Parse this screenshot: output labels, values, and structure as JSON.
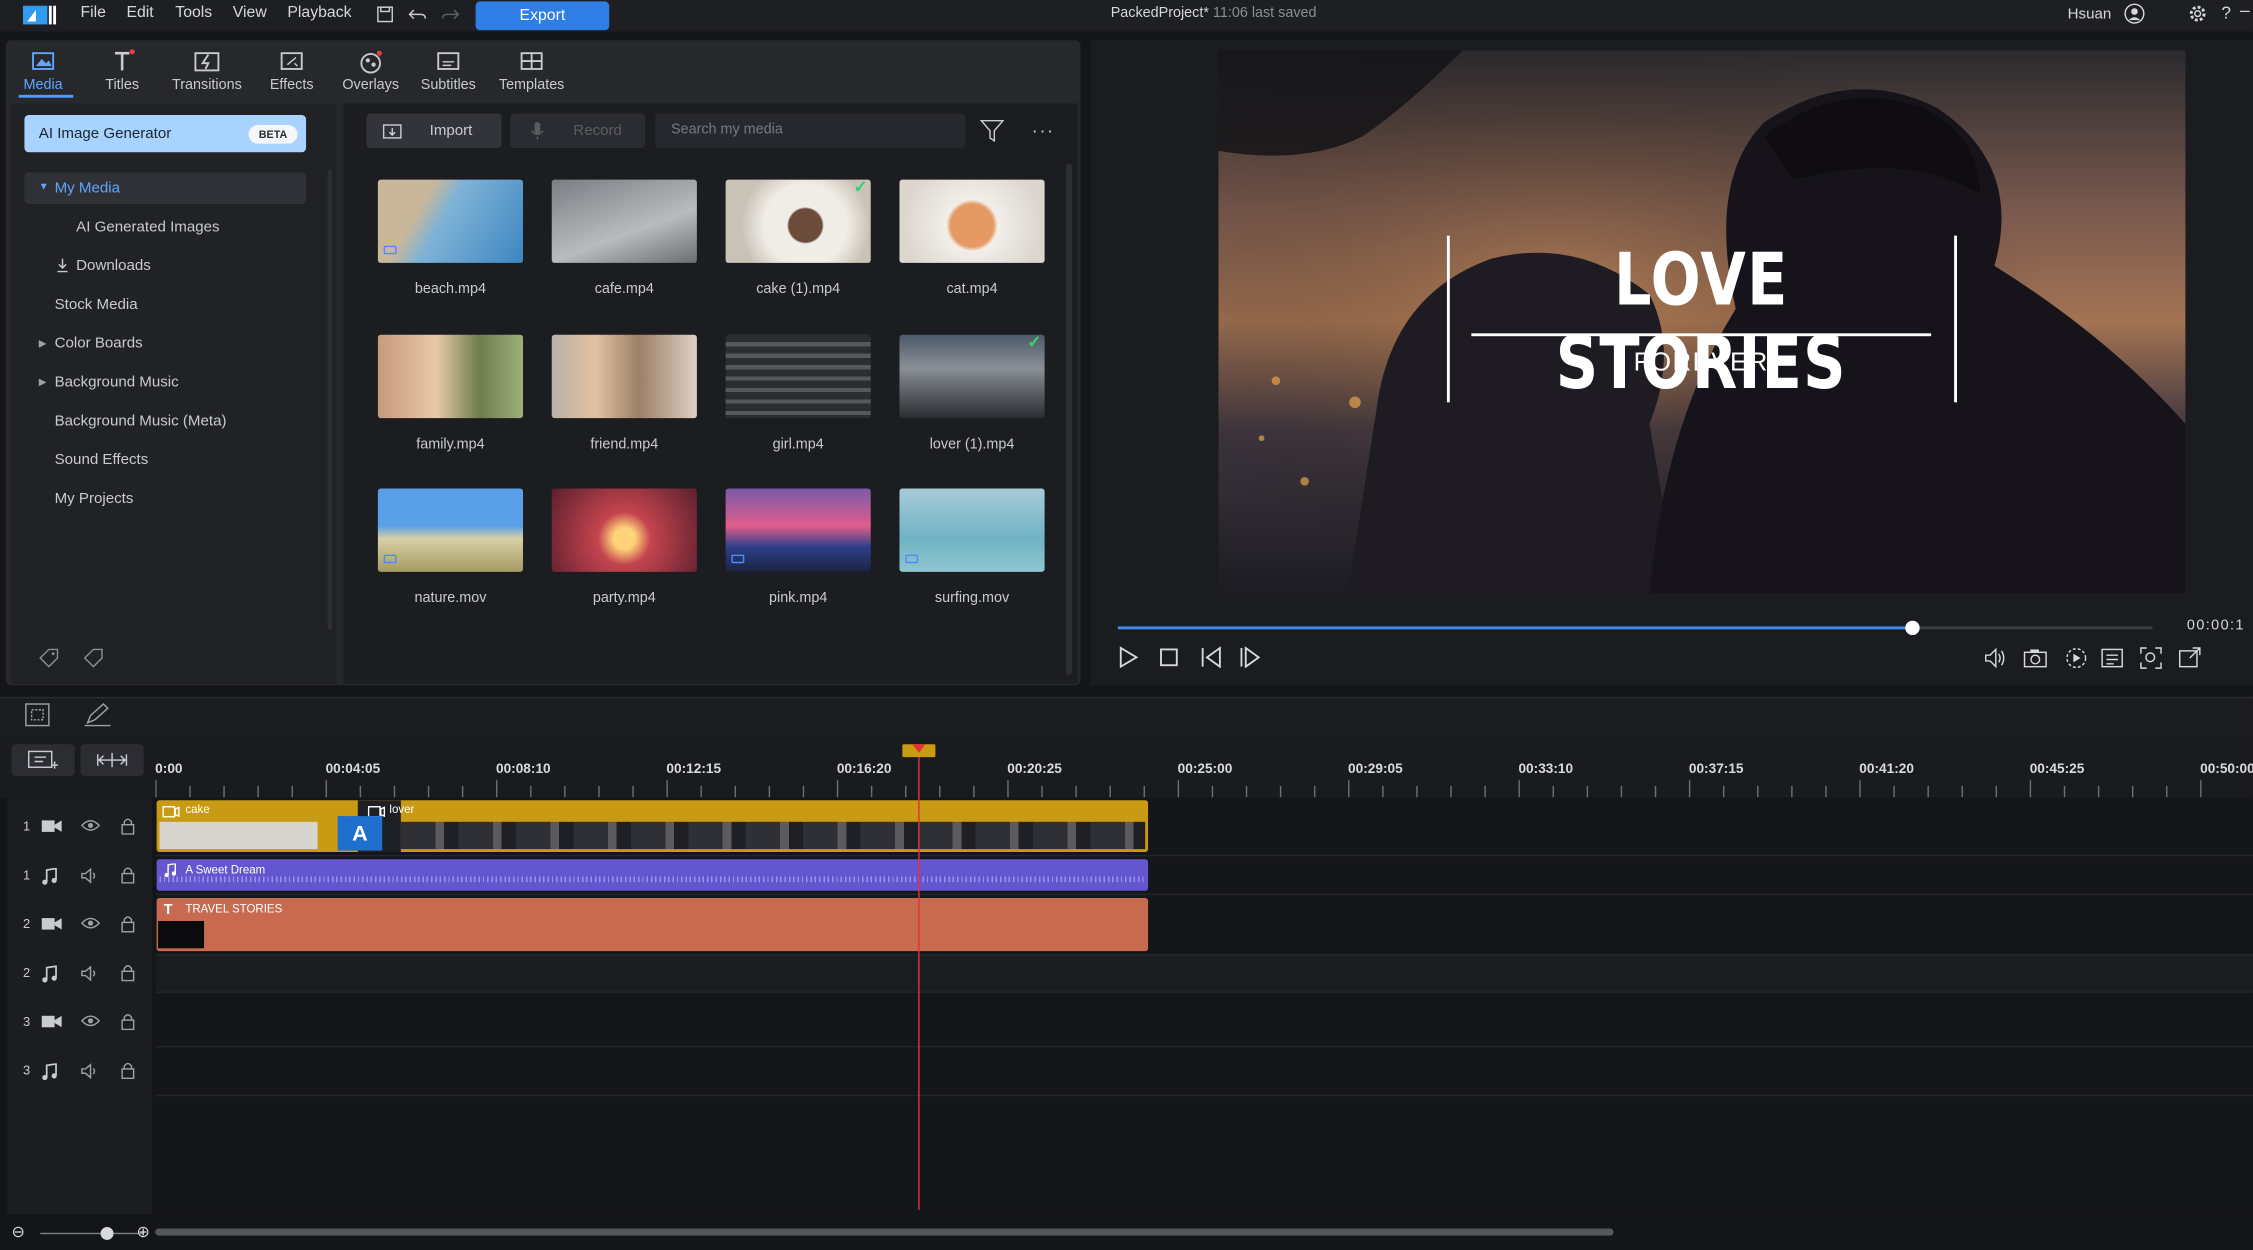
{
  "menu": {
    "items": [
      "File",
      "Edit",
      "Tools",
      "View",
      "Playback"
    ],
    "export_label": "Export"
  },
  "project": {
    "name": "PackedProject*",
    "saved": "11:06 last saved"
  },
  "user": {
    "name": "Hsuan"
  },
  "tabs": [
    {
      "label": "Media",
      "icon": "media-icon",
      "active": true
    },
    {
      "label": "Titles",
      "icon": "titles-icon"
    },
    {
      "label": "Transitions",
      "icon": "transitions-icon"
    },
    {
      "label": "Effects",
      "icon": "effects-icon"
    },
    {
      "label": "Overlays",
      "icon": "overlays-icon"
    },
    {
      "label": "Subtitles",
      "icon": "subtitles-icon"
    },
    {
      "label": "Templates",
      "icon": "templates-icon"
    }
  ],
  "sidebar": {
    "ai_generator": "AI Image Generator",
    "beta": "BETA",
    "items": [
      {
        "label": "My Media",
        "expanded": true
      },
      {
        "label": "AI Generated Images"
      },
      {
        "label": "Downloads"
      },
      {
        "label": "Stock Media"
      },
      {
        "label": "Color Boards"
      },
      {
        "label": "Background Music"
      },
      {
        "label": "Background Music (Meta)"
      },
      {
        "label": "Sound Effects"
      },
      {
        "label": "My Projects"
      }
    ]
  },
  "browser": {
    "import_label": "Import",
    "record_label": "Record",
    "search_placeholder": "Search my media",
    "items": [
      {
        "name": "beach.mp4",
        "in_use": false
      },
      {
        "name": "cafe.mp4",
        "in_use": false
      },
      {
        "name": "cake (1).mp4",
        "in_use": true
      },
      {
        "name": "cat.mp4",
        "in_use": false
      },
      {
        "name": "family.mp4",
        "in_use": false
      },
      {
        "name": "friend.mp4",
        "in_use": false
      },
      {
        "name": "girl.mp4",
        "in_use": false
      },
      {
        "name": "lover (1).mp4",
        "in_use": true
      },
      {
        "name": "nature.mov",
        "in_use": false
      },
      {
        "name": "party.mp4",
        "in_use": false
      },
      {
        "name": "pink.mp4",
        "in_use": false
      },
      {
        "name": "surfing.mov",
        "in_use": false
      }
    ]
  },
  "preview": {
    "title": "LOVE STORIES",
    "subtitle": "FOREVER",
    "timecode": "00:00:1",
    "progress": 0.768
  },
  "timeline": {
    "ruler": [
      "0:00",
      "00:04:05",
      "00:08:10",
      "00:12:15",
      "00:16:20",
      "00:20:25",
      "00:25:00",
      "00:29:05",
      "00:33:10",
      "00:37:15",
      "00:41:20",
      "00:45:25",
      "00:50:00"
    ],
    "tracks": [
      {
        "num": "1",
        "type": "video"
      },
      {
        "num": "1",
        "type": "audio"
      },
      {
        "num": "2",
        "type": "video"
      },
      {
        "num": "2",
        "type": "audio"
      },
      {
        "num": "3",
        "type": "video"
      },
      {
        "num": "3",
        "type": "audio"
      }
    ],
    "clips": {
      "video1a": "cake",
      "video1b": "lover",
      "transition": "A",
      "audio": "A Sweet Dream",
      "title": "TRAVEL STORIES"
    }
  },
  "colors": {
    "accent": "#2f7ee6",
    "video_clip": "#c99a14",
    "audio_clip": "#6456cf",
    "title_clip": "#c86a50",
    "playhead": "#e03434"
  }
}
